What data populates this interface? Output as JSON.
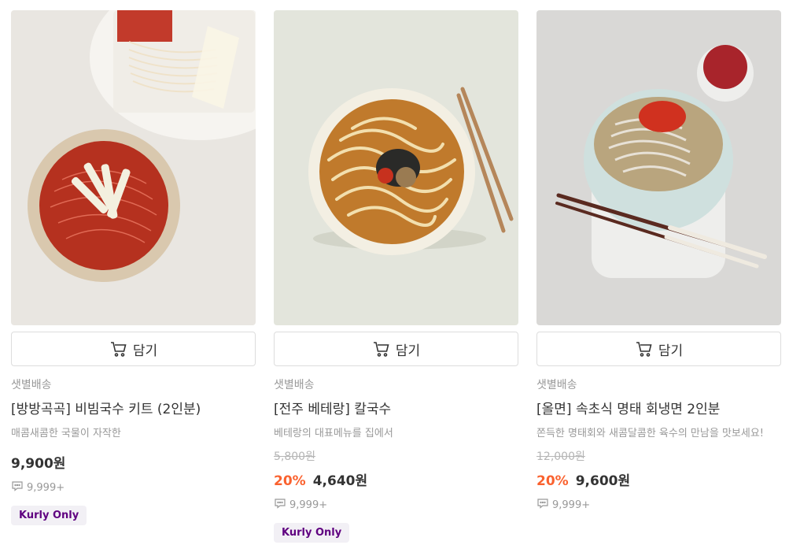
{
  "products": [
    {
      "cart_label": "담기",
      "delivery": "샛별배송",
      "name": "[방방곡곡] 비빔국수 키트 (2인분)",
      "description": "매콤새콤한 국물이 자작한",
      "original_price": "",
      "discount": "",
      "price": "9,900원",
      "review_count": "9,999+",
      "badge": "Kurly Only"
    },
    {
      "cart_label": "담기",
      "delivery": "샛별배송",
      "name": "[전주 베테랑] 칼국수",
      "description": "베테랑의 대표메뉴를 집에서",
      "original_price": "5,800원",
      "discount": "20%",
      "price": "4,640원",
      "review_count": "9,999+",
      "badge": "Kurly Only"
    },
    {
      "cart_label": "담기",
      "delivery": "샛별배송",
      "name": "[올면] 속초식 명태 회냉면 2인분",
      "description": "쫀득한 명태회와 새콤달콤한 육수의 만남을 맛보세요!",
      "original_price": "12,000원",
      "discount": "20%",
      "price": "9,600원",
      "review_count": "9,999+",
      "badge": ""
    }
  ],
  "colors": {
    "accent": "#5f0080",
    "discount": "#fa622f",
    "badge_bg": "#f2f0f5"
  },
  "icons": {
    "cart": "cart-icon",
    "review": "speech-bubble-icon"
  }
}
